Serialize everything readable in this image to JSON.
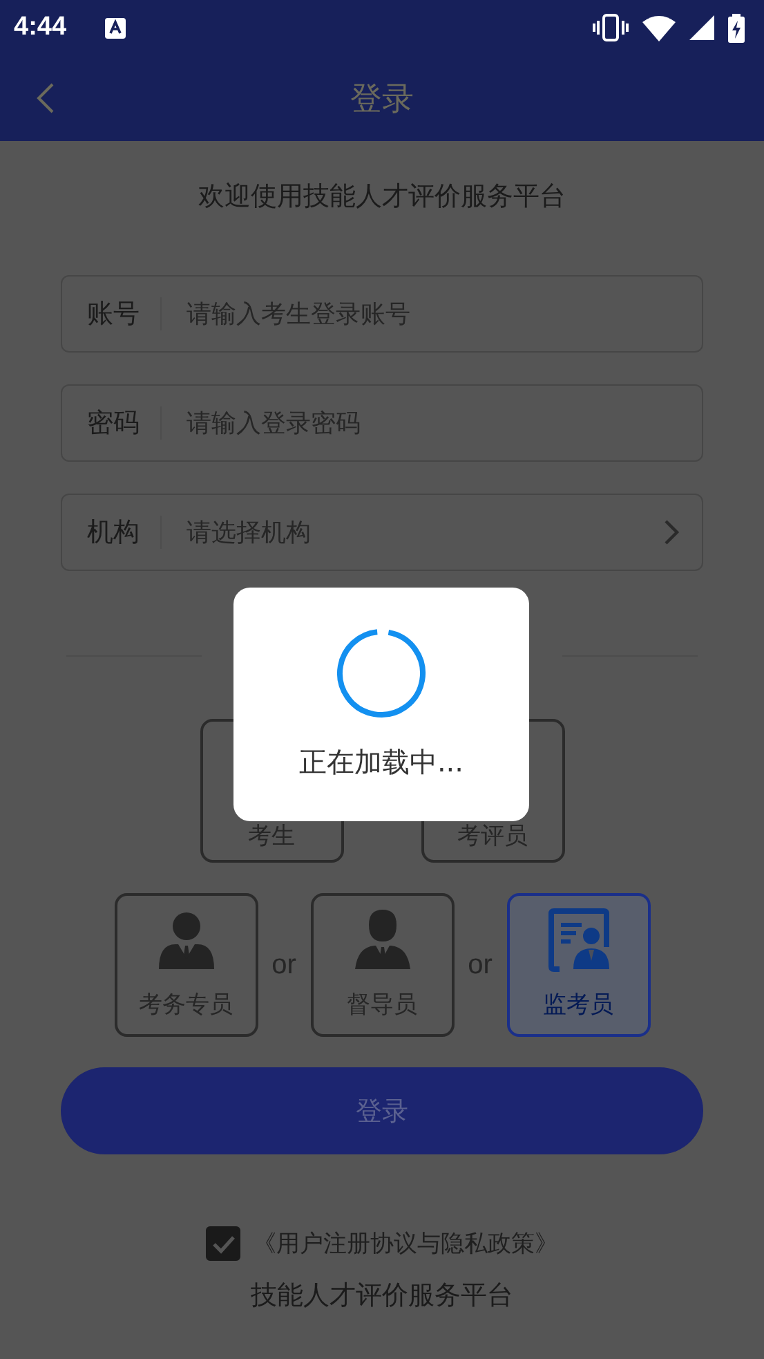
{
  "status_bar": {
    "time": "4:44"
  },
  "header": {
    "title": "登录"
  },
  "welcome": "欢迎使用技能人才评价服务平台",
  "fields": [
    {
      "kind": "text",
      "label": "账号",
      "placeholder": "请输入考生登录账号"
    },
    {
      "kind": "password",
      "label": "密码",
      "placeholder": "请输入登录密码"
    },
    {
      "kind": "select",
      "label": "机构",
      "placeholder": "请选择机构"
    }
  ],
  "role_rows": [
    [
      {
        "kind": "role",
        "label": "考生",
        "selected": false
      },
      {
        "kind": "role",
        "label": "考评员",
        "selected": false
      }
    ],
    [
      {
        "kind": "role",
        "label": "考务专员",
        "selected": false
      },
      {
        "kind": "separator",
        "label": "or"
      },
      {
        "kind": "role",
        "label": "督导员",
        "selected": false
      },
      {
        "kind": "separator",
        "label": "or"
      },
      {
        "kind": "role",
        "label": "监考员",
        "selected": true
      }
    ]
  ],
  "login_button": "登录",
  "agreement": {
    "checked": true,
    "text": "《用户注册协议与隐私政策》"
  },
  "footer": "技能人才评价服务平台",
  "dialog": {
    "message": "正在加载中..."
  }
}
